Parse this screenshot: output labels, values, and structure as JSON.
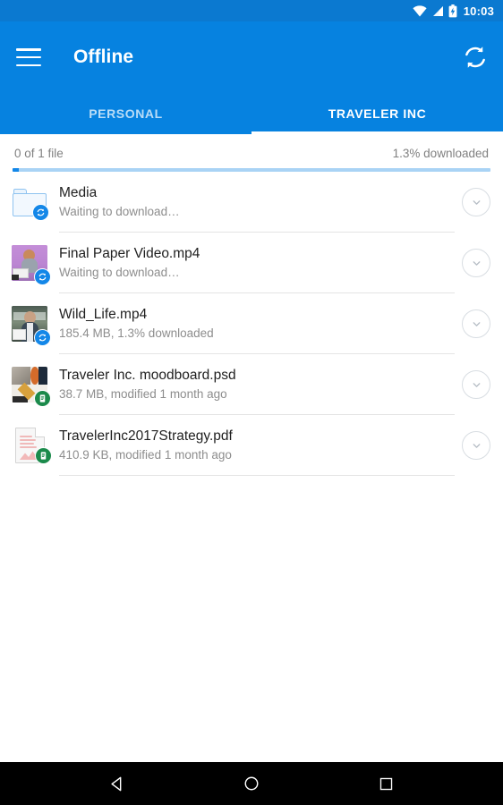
{
  "statusbar": {
    "time": "10:03",
    "icons": [
      "wifi-icon",
      "cell-signal-icon",
      "battery-charging-icon"
    ]
  },
  "appbar": {
    "menu_icon": "hamburger-menu-icon",
    "title": "Offline",
    "refresh_icon": "refresh-sync-icon",
    "background_color": "#0682e0"
  },
  "tabs": {
    "items": [
      {
        "label": "PERSONAL",
        "active": false
      },
      {
        "label": "TRAVELER INC",
        "active": true
      }
    ]
  },
  "progress": {
    "left_label": "0 of 1 file",
    "right_label": "1.3% downloaded",
    "percent": 1.3,
    "fill_color": "#1387e8",
    "track_color": "#a9d3f5"
  },
  "files": [
    {
      "name": "Media",
      "meta": "Waiting to download…",
      "icon": "folder-icon",
      "badge": "sync-badge",
      "badge_color": "#1387e8",
      "action_icon": "chevron-down-icon"
    },
    {
      "name": "Final Paper Video.mp4",
      "meta": "Waiting to download…",
      "icon": "video-thumbnail",
      "badge": "sync-badge",
      "badge_color": "#1387e8",
      "action_icon": "chevron-down-icon"
    },
    {
      "name": "Wild_Life.mp4",
      "meta": "185.4 MB, 1.3% downloaded",
      "icon": "video-thumbnail",
      "badge": "sync-badge",
      "badge_color": "#1387e8",
      "action_icon": "chevron-down-icon"
    },
    {
      "name": "Traveler Inc. moodboard.psd",
      "meta": "38.7 MB, modified 1 month ago",
      "icon": "image-thumbnail",
      "badge": "offline-available-badge",
      "badge_color": "#1b8a4b",
      "action_icon": "chevron-down-icon"
    },
    {
      "name": "TravelerInc2017Strategy.pdf",
      "meta": "410.9 KB, modified 1 month ago",
      "icon": "pdf-document-icon",
      "badge": "offline-available-badge",
      "badge_color": "#1b8a4b",
      "action_icon": "chevron-down-icon"
    }
  ],
  "navbar": {
    "back": "back-triangle-icon",
    "home": "home-circle-icon",
    "recents": "recents-square-icon"
  }
}
